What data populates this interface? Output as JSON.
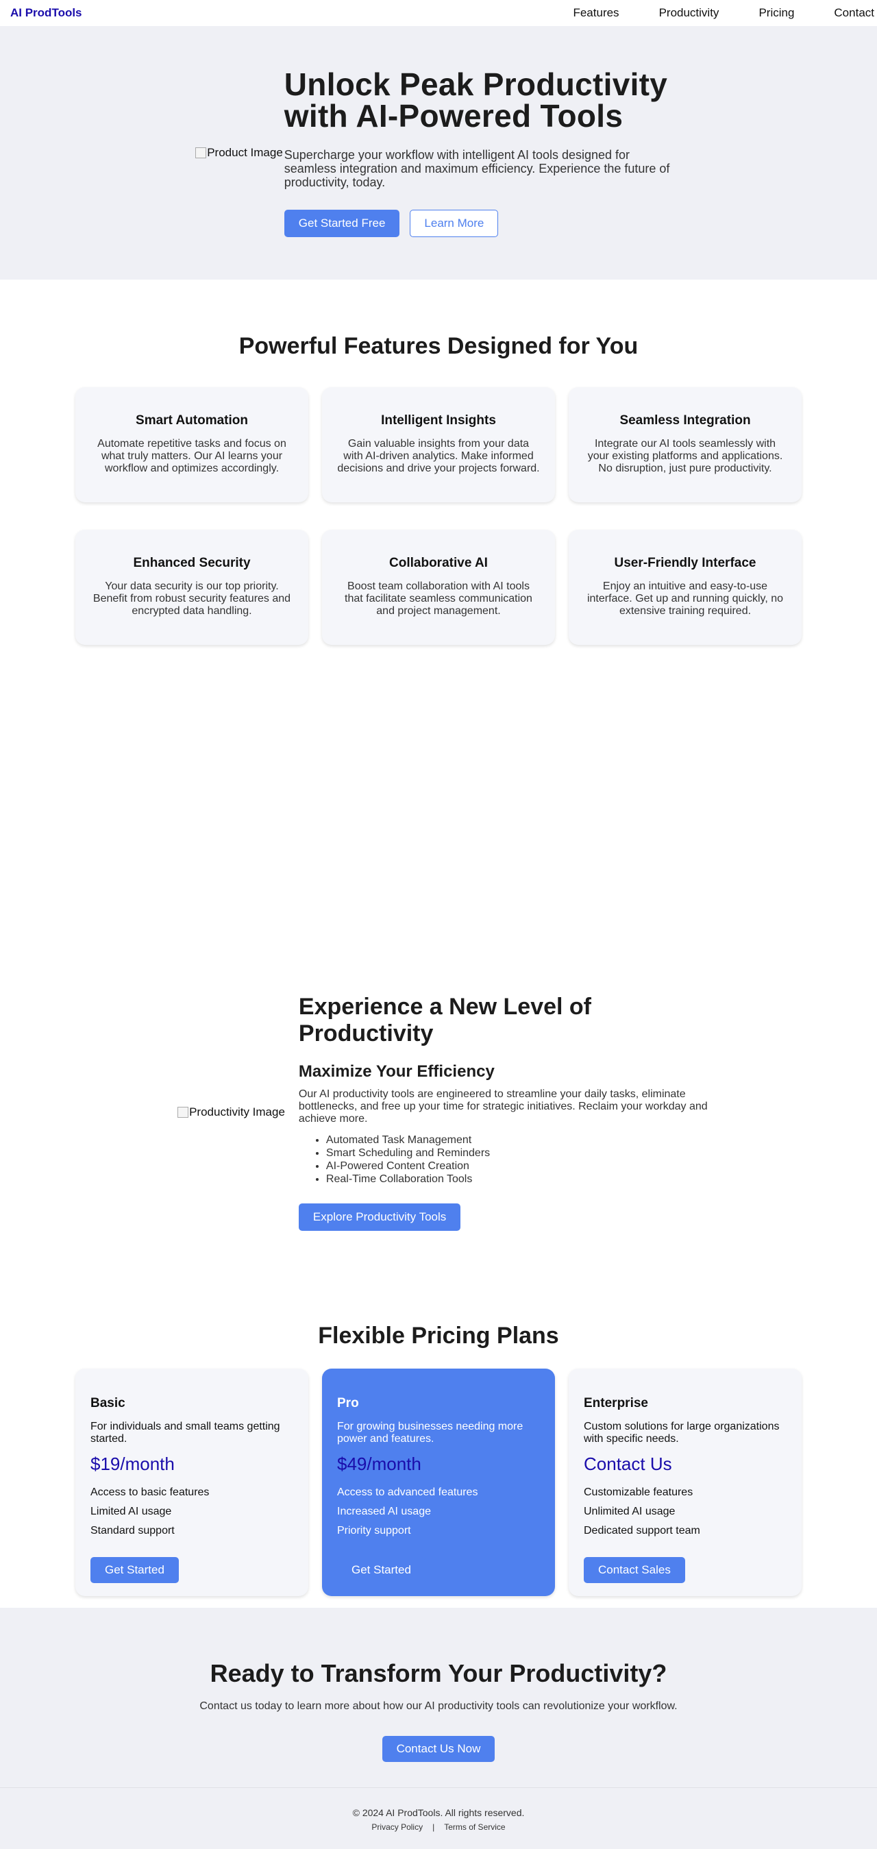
{
  "nav": {
    "brand": "AI ProdTools",
    "links": [
      "Features",
      "Productivity",
      "Pricing",
      "Contact"
    ]
  },
  "hero": {
    "image_alt": "Product Image",
    "title": "Unlock Peak Productivity with AI-Powered Tools",
    "subtitle": "Supercharge your workflow with intelligent AI tools designed for seamless integration and maximum efficiency. Experience the future of productivity, today.",
    "primary_button": "Get Started Free",
    "secondary_button": "Learn More"
  },
  "features": {
    "title": "Powerful Features Designed for You",
    "items": [
      {
        "title": "Smart Automation",
        "text": "Automate repetitive tasks and focus on what truly matters. Our AI learns your workflow and optimizes accordingly."
      },
      {
        "title": "Intelligent Insights",
        "text": "Gain valuable insights from your data with AI-driven analytics. Make informed decisions and drive your projects forward."
      },
      {
        "title": "Seamless Integration",
        "text": "Integrate our AI tools seamlessly with your existing platforms and applications. No disruption, just pure productivity."
      },
      {
        "title": "Enhanced Security",
        "text": "Your data security is our top priority. Benefit from robust security features and encrypted data handling."
      },
      {
        "title": "Collaborative AI",
        "text": "Boost team collaboration with AI tools that facilitate seamless communication and project management."
      },
      {
        "title": "User-Friendly Interface",
        "text": "Enjoy an intuitive and easy-to-use interface. Get up and running quickly, no extensive training required."
      }
    ]
  },
  "productivity": {
    "image_alt": "Productivity Image",
    "title": "Experience a New Level of Productivity",
    "subtitle": "Maximize Your Efficiency",
    "text": "Our AI productivity tools are engineered to streamline your daily tasks, eliminate bottlenecks, and free up your time for strategic initiatives. Reclaim your workday and achieve more.",
    "list": [
      "Automated Task Management",
      "Smart Scheduling and Reminders",
      "AI-Powered Content Creation",
      "Real-Time Collaboration Tools"
    ],
    "button": "Explore Productivity Tools"
  },
  "pricing": {
    "title": "Flexible Pricing Plans",
    "plans": [
      {
        "name": "Basic",
        "desc": "For individuals and small teams getting started.",
        "price": "$19/month",
        "features": [
          "Access to basic features",
          "Limited AI usage",
          "Standard support"
        ],
        "button": "Get Started"
      },
      {
        "name": "Pro",
        "desc": "For growing businesses needing more power and features.",
        "price": "$49/month",
        "features": [
          "Access to advanced features",
          "Increased AI usage",
          "Priority support"
        ],
        "button": "Get Started"
      },
      {
        "name": "Enterprise",
        "desc": "Custom solutions for large organizations with specific needs.",
        "price": "Contact Us",
        "features": [
          "Customizable features",
          "Unlimited AI usage",
          "Dedicated support team"
        ],
        "button": "Contact Sales"
      }
    ]
  },
  "cta": {
    "title": "Ready to Transform Your Productivity?",
    "text": "Contact us today to learn more about how our AI productivity tools can revolutionize your workflow.",
    "button": "Contact Us Now"
  },
  "footer": {
    "copyright": "© 2024 AI ProdTools. All rights reserved.",
    "privacy": "Privacy Policy",
    "separator": "|",
    "terms": "Terms of Service"
  },
  "colors": {
    "accent": "#4f80ee",
    "brand": "#1a0dab",
    "section_bg": "#eff0f5",
    "card_bg": "#f5f6fa"
  }
}
